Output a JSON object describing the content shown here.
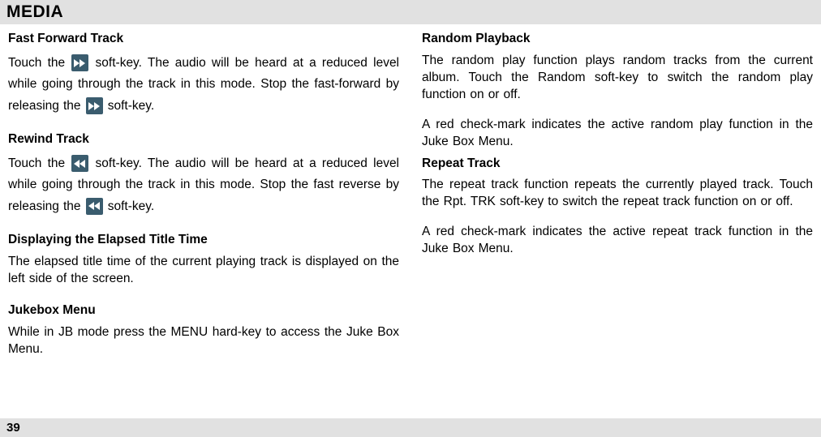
{
  "header": {
    "title": "MEDIA"
  },
  "left_column": {
    "section1": {
      "title": "Fast Forward Track",
      "para1_a": "Touch the ",
      "para1_b": " soft-key. The audio will be heard at a reduced level while going through the track in this mode. Stop the fast-forward by releasing the ",
      "para1_c": " soft-key."
    },
    "section2": {
      "title": "Rewind Track",
      "para1_a": "Touch the ",
      "para1_b": " soft-key. The audio will be heard at a reduced level while going through the track in this mode. Stop the fast reverse by releasing the ",
      "para1_c": " soft-key."
    },
    "section3": {
      "title": "Displaying the Elapsed Title Time",
      "para1": "The elapsed title time of the current playing track is displayed on the left side of the screen."
    },
    "section4": {
      "title": "Jukebox Menu",
      "para1": "While in JB mode press the MENU hard-key to access the Juke Box Menu."
    }
  },
  "right_column": {
    "section1": {
      "title": "Random Playback",
      "para1": "The random play function plays random tracks from the current album. Touch the Random soft-key to switch the random play function on or off.",
      "para2": "A red check-mark indicates the active random play function in the Juke Box Menu."
    },
    "section2": {
      "title": "Repeat Track",
      "para1": "The repeat track function repeats the currently played track. Touch the Rpt. TRK soft-key to switch the repeat track function on or off.",
      "para2": "A red check-mark indicates the active repeat track function in the Juke Box Menu."
    }
  },
  "footer": {
    "page_number": "39"
  }
}
